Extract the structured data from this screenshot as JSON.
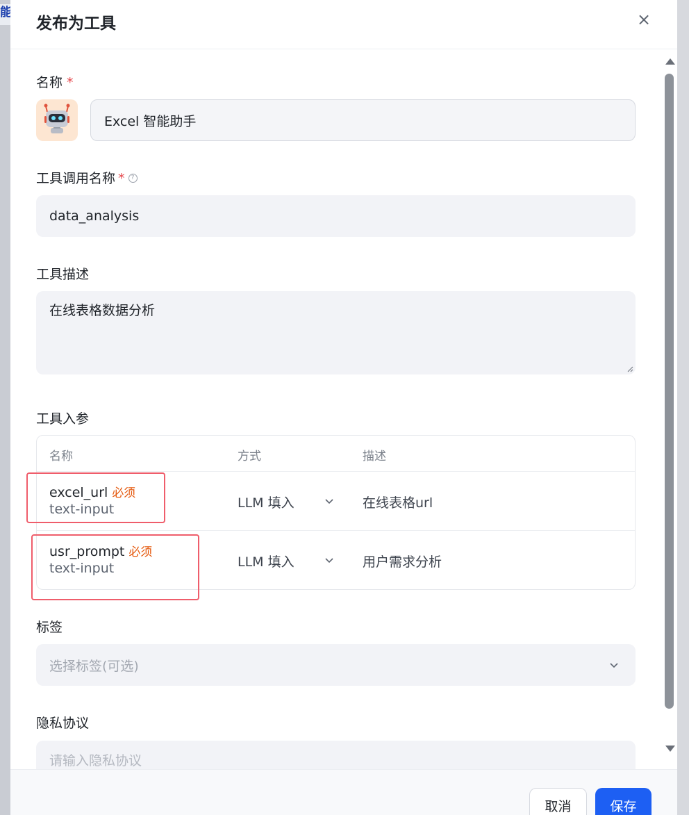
{
  "background": {
    "side_text": "能"
  },
  "dialog": {
    "title": "发布为工具",
    "close_glyph": "×"
  },
  "form": {
    "name": {
      "label": "名称",
      "required_mark": "*",
      "value": "Excel 智能助手"
    },
    "tool_call_name": {
      "label": "工具调用名称",
      "required_mark": "*",
      "help_glyph": "?",
      "value": "data_analysis"
    },
    "tool_description": {
      "label": "工具描述",
      "value": "在线表格数据分析"
    },
    "tool_params": {
      "label": "工具入参",
      "columns": [
        "名称",
        "方式",
        "描述"
      ],
      "rows": [
        {
          "name": "excel_url",
          "required": "必须",
          "type": "text-input",
          "mode": "LLM 填入",
          "description": "在线表格url"
        },
        {
          "name": "usr_prompt",
          "required": "必须",
          "type": "text-input",
          "mode": "LLM 填入",
          "description": "用户需求分析"
        }
      ]
    },
    "tags": {
      "label": "标签",
      "placeholder": "选择标签(可选)"
    },
    "privacy": {
      "label": "隐私协议",
      "placeholder": "请输入隐私协议"
    }
  },
  "footer": {
    "cancel_label": "取消",
    "save_label": "保存"
  },
  "colors": {
    "primary": "#1d5ff3",
    "required": "#e5484d",
    "highlight": "#ef5d6b"
  }
}
